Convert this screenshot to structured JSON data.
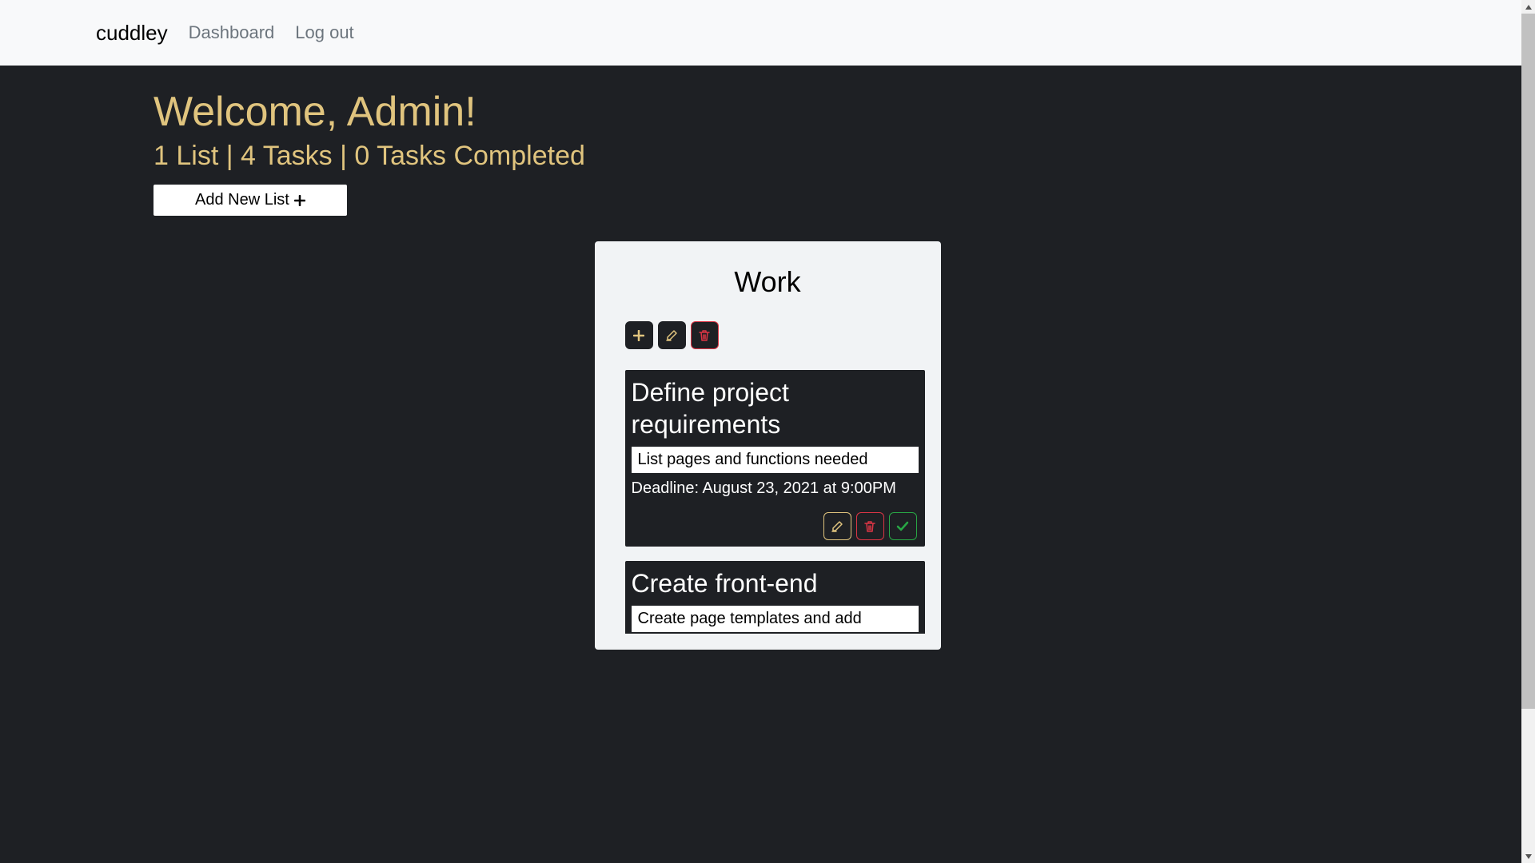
{
  "navbar": {
    "brand": "cuddley",
    "links": [
      "Dashboard",
      "Log out"
    ]
  },
  "welcome": {
    "title": "Welcome, Admin!",
    "stats": "1 List | 4 Tasks | 0 Tasks Completed",
    "addListLabel": "Add New List"
  },
  "list": {
    "title": "Work",
    "tasks": [
      {
        "title": "Define project requirements",
        "description": "List pages and functions needed",
        "deadline": "Deadline: August 23, 2021 at 9:00PM"
      },
      {
        "title": "Create front-end",
        "description": "Create page templates and add"
      }
    ]
  },
  "icons": {
    "plus": "plus-icon",
    "edit": "edit-icon",
    "trash": "trash-icon",
    "check": "check-icon"
  }
}
